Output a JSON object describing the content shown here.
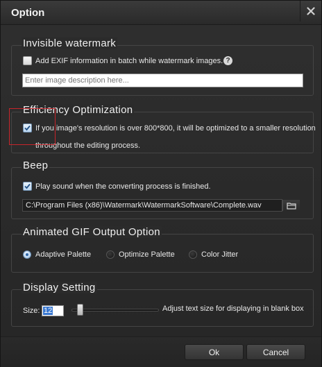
{
  "window": {
    "title": "Option"
  },
  "invisible_watermark": {
    "title": "Invisible watermark",
    "exif_label": "Add EXIF information in batch while watermark images.",
    "exif_checked": false,
    "help_icon": "question-icon",
    "description_placeholder": "Enter image description here..."
  },
  "efficiency": {
    "title": "Efficiency Optimization",
    "checked": true,
    "label_line1": "If you image's resolution is over 800*800, it will be optimized to a smaller resolution",
    "label_line2": "throughout the editing process."
  },
  "beep": {
    "title": "Beep",
    "checked": true,
    "label": "Play sound when the converting process is finished.",
    "path": "C:\\Program Files (x86)\\Watermark\\WatermarkSoftware\\Complete.wav",
    "folder_icon": "folder-icon"
  },
  "gif": {
    "title": "Animated GIF Output Option",
    "options": [
      {
        "label": "Adaptive Palette",
        "selected": true
      },
      {
        "label": "Optimize Palette",
        "selected": false
      },
      {
        "label": "Color Jitter",
        "selected": false
      }
    ]
  },
  "display": {
    "title": "Display Setting",
    "size_label": "Size:",
    "size_value": "12",
    "hint": "Adjust text size for displaying in blank box",
    "slider_fraction": 0.07
  },
  "footer": {
    "ok_label": "Ok",
    "cancel_label": "Cancel"
  },
  "colors": {
    "accent": "#3a78d0",
    "highlight": "#c8252b",
    "background": "#2b2b2b"
  }
}
